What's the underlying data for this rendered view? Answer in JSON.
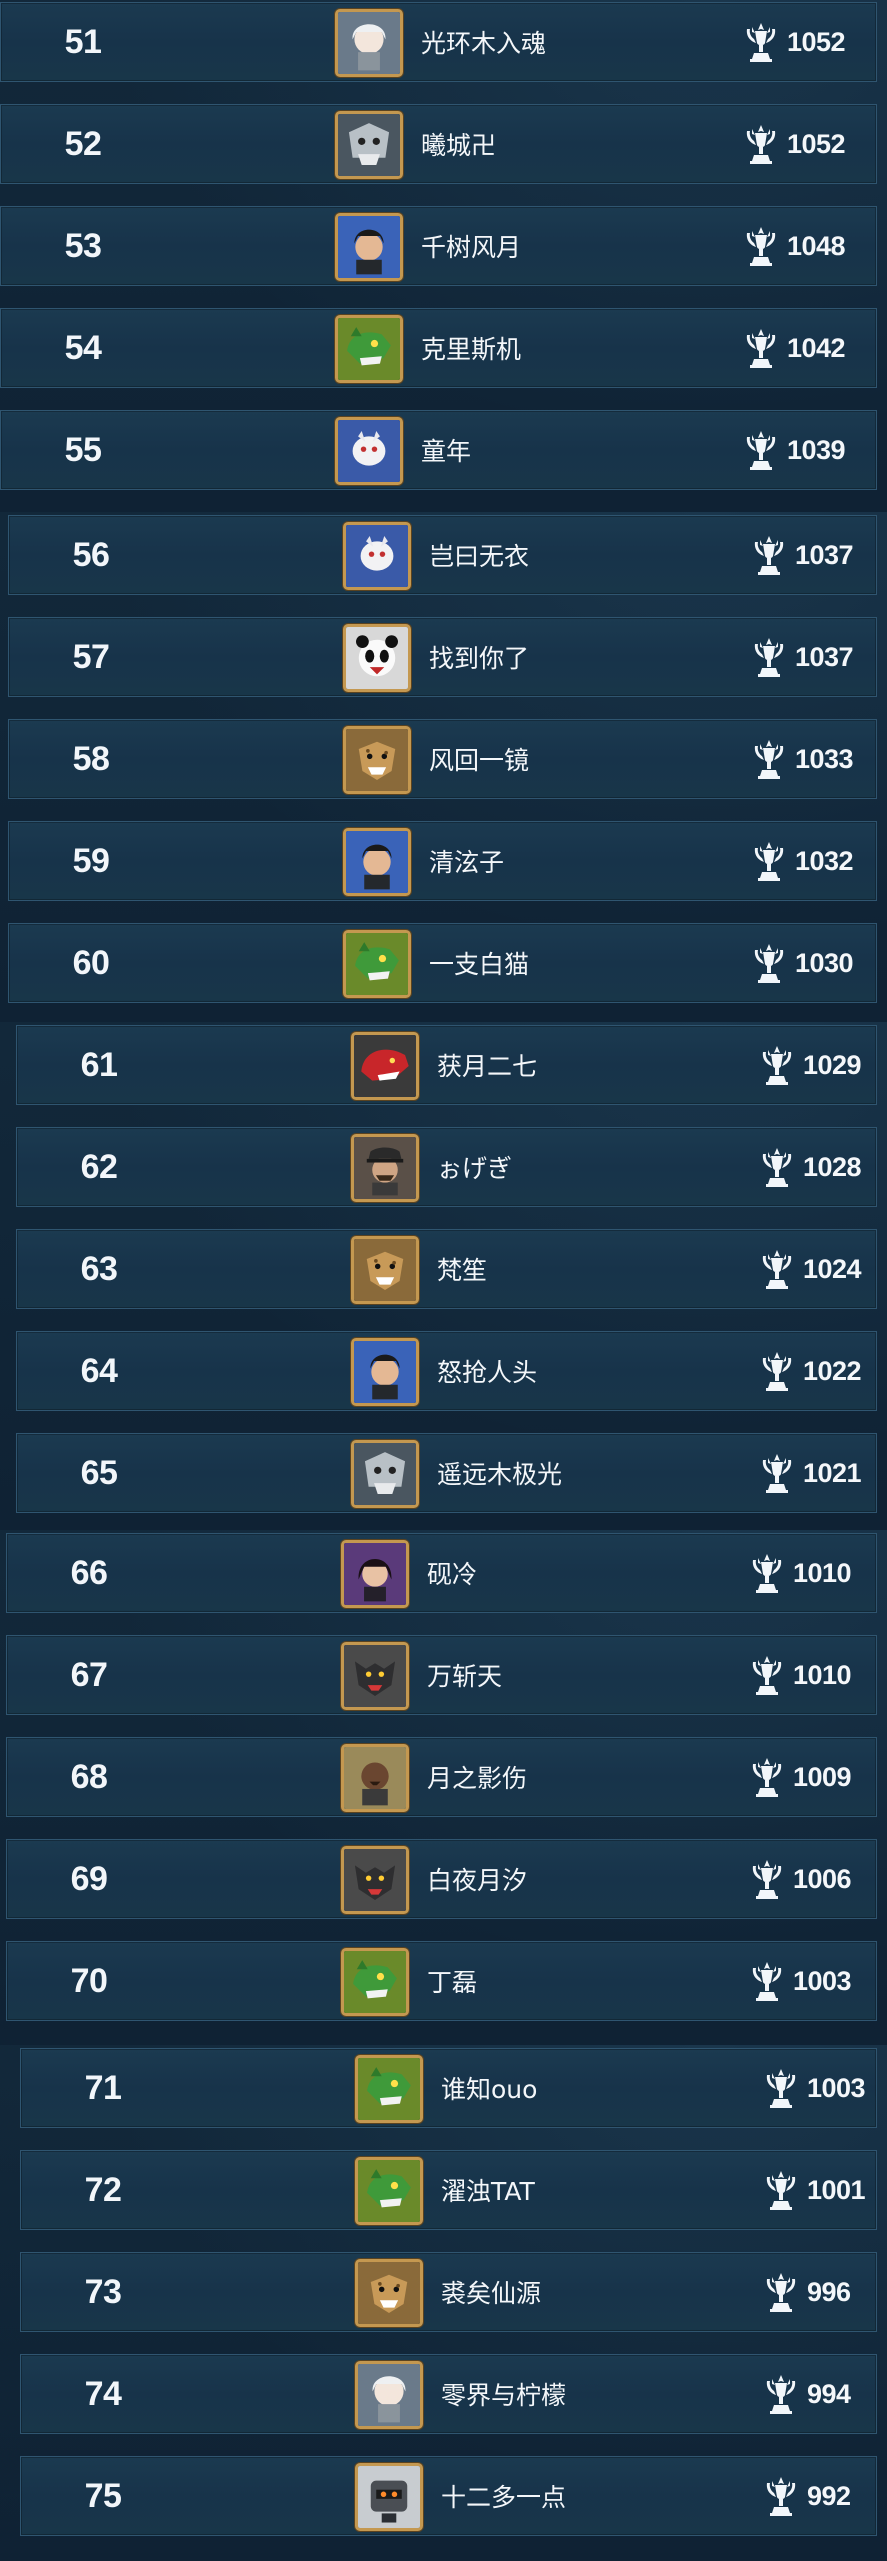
{
  "leaderboard": [
    {
      "rank": "51",
      "name": "光环木入魂",
      "score": "1052",
      "avatar": "white-haired-girl-avatar"
    },
    {
      "rank": "52",
      "name": "曦城卍",
      "score": "1052",
      "avatar": "armored-beast-avatar"
    },
    {
      "rank": "53",
      "name": "千树风月",
      "score": "1048",
      "avatar": "dark-haired-man-avatar"
    },
    {
      "rank": "54",
      "name": "克里斯机",
      "score": "1042",
      "avatar": "green-dragon-avatar"
    },
    {
      "rank": "55",
      "name": "童年",
      "score": "1039",
      "avatar": "white-creature-avatar"
    },
    {
      "rank": "56",
      "name": "岂曰无衣",
      "score": "1037",
      "avatar": "white-creature-avatar"
    },
    {
      "rank": "57",
      "name": "找到你了",
      "score": "1037",
      "avatar": "panda-avatar"
    },
    {
      "rank": "58",
      "name": "风回一镜",
      "score": "1033",
      "avatar": "hyena-avatar"
    },
    {
      "rank": "59",
      "name": "清泫子",
      "score": "1032",
      "avatar": "dark-haired-man-avatar"
    },
    {
      "rank": "60",
      "name": "一支白猫",
      "score": "1030",
      "avatar": "green-dragon-avatar"
    },
    {
      "rank": "61",
      "name": "获月二七",
      "score": "1029",
      "avatar": "red-dragon-avatar"
    },
    {
      "rank": "62",
      "name": "ぉげぎ",
      "score": "1028",
      "avatar": "officer-avatar"
    },
    {
      "rank": "63",
      "name": "梵笙",
      "score": "1024",
      "avatar": "hyena-avatar"
    },
    {
      "rank": "64",
      "name": "怒抢人头",
      "score": "1022",
      "avatar": "dark-haired-man-avatar"
    },
    {
      "rank": "65",
      "name": "遥远木极光",
      "score": "1021",
      "avatar": "armored-beast-avatar"
    },
    {
      "rank": "66",
      "name": "砚冷",
      "score": "1010",
      "avatar": "long-haired-man-avatar"
    },
    {
      "rank": "67",
      "name": "万斩天",
      "score": "1010",
      "avatar": "wolf-avatar"
    },
    {
      "rank": "68",
      "name": "月之影伤",
      "score": "1009",
      "avatar": "bald-man-avatar"
    },
    {
      "rank": "69",
      "name": "白夜月汐",
      "score": "1006",
      "avatar": "wolf-avatar"
    },
    {
      "rank": "70",
      "name": "丁磊",
      "score": "1003",
      "avatar": "green-dragon-avatar"
    },
    {
      "rank": "71",
      "name": "谁知ouo",
      "score": "1003",
      "avatar": "green-dragon-avatar"
    },
    {
      "rank": "72",
      "name": "濯浊TAT",
      "score": "1001",
      "avatar": "green-dragon-avatar"
    },
    {
      "rank": "73",
      "name": "裘矣仙源",
      "score": "996",
      "avatar": "hyena-avatar"
    },
    {
      "rank": "74",
      "name": "零界与柠檬",
      "score": "994",
      "avatar": "white-haired-girl-avatar"
    },
    {
      "rank": "75",
      "name": "十二多一点",
      "score": "992",
      "avatar": "robot-avatar"
    }
  ],
  "colors": {
    "row_bg": "#1a3850",
    "row_border": "#2f5570",
    "avatar_frame": "#c49850",
    "text": "#f4f7fa"
  }
}
